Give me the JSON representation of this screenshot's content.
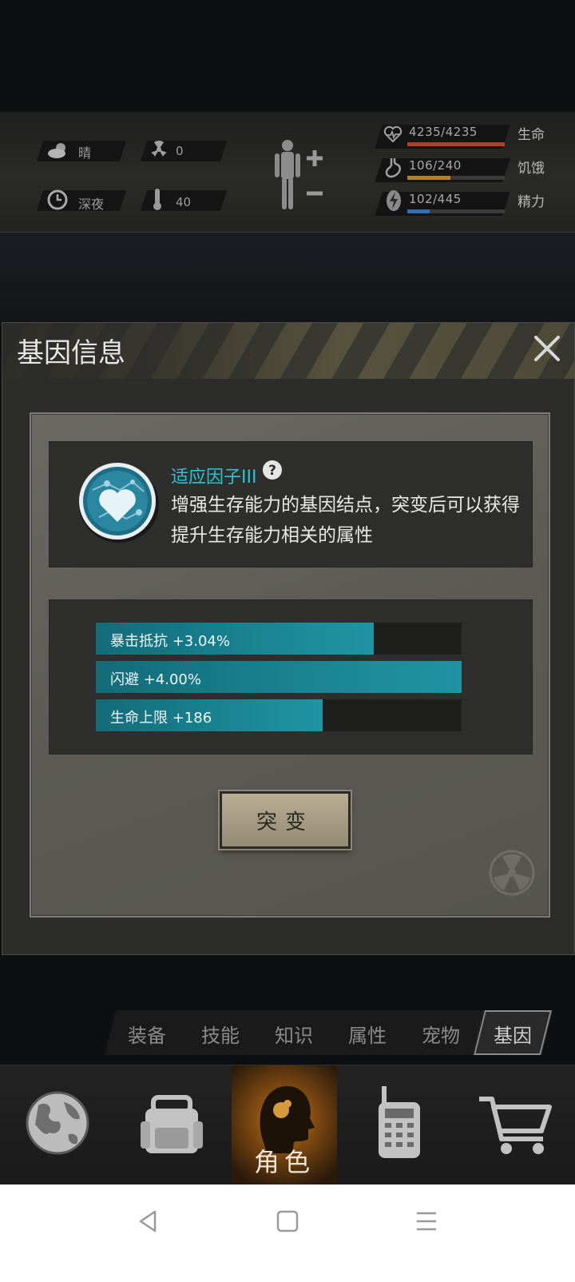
{
  "status": {
    "weather_label": "晴",
    "radiation_value": "0",
    "time_label": "深夜",
    "temperature_value": "40",
    "stats": [
      {
        "label": "生命",
        "value": "4235/4235",
        "fill": 1.0,
        "color": "#b0402a"
      },
      {
        "label": "饥饿",
        "value": "106/240",
        "fill": 0.4417,
        "color": "#b3802a"
      },
      {
        "label": "精力",
        "value": "102/445",
        "fill": 0.2292,
        "color": "#2f6fb4"
      }
    ]
  },
  "dialog": {
    "title": "基因信息",
    "gene": {
      "name": "适应因子III",
      "description": "增强生存能力的基因结点，突变后可以获得提升生存能力相关的属性"
    },
    "attributes": [
      {
        "label": "暴击抵抗 +3.04%",
        "fill": 0.76
      },
      {
        "label": "闪避 +4.00%",
        "fill": 1.0
      },
      {
        "label": "生命上限 +186",
        "fill": 0.62
      }
    ],
    "mutate_button": "突变"
  },
  "tabs": [
    "装备",
    "技能",
    "知识",
    "属性",
    "宠物",
    "基因"
  ],
  "active_tab": "基因",
  "bottom_nav": {
    "role_label": "角色"
  },
  "icons": {
    "weather": "partly-cloudy-icon",
    "radiation": "radiation-icon",
    "time": "clock-icon",
    "temperature": "thermometer-icon",
    "health": "heart-icon",
    "hunger": "stomach-icon",
    "energy": "lightning-icon"
  }
}
